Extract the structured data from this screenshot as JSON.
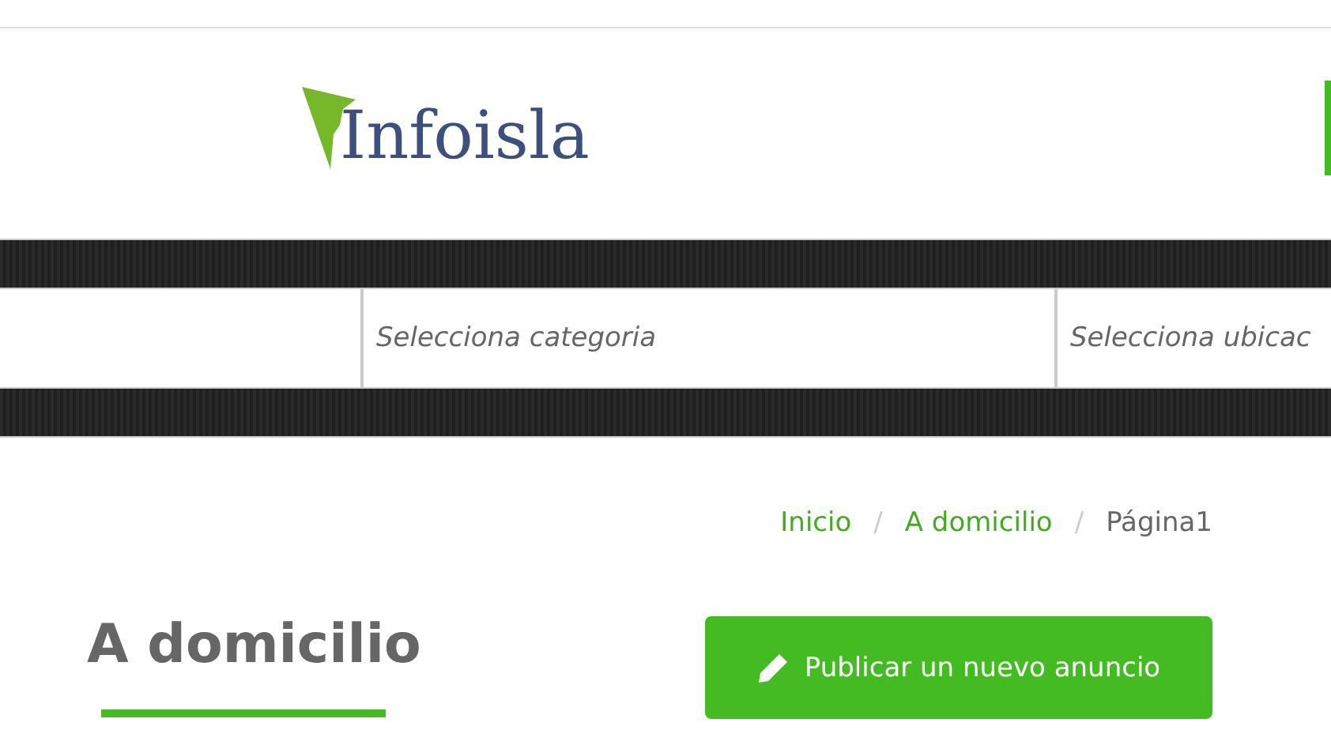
{
  "header": {
    "logo": {
      "text": "Infoisla"
    }
  },
  "search_bar": {
    "fields": [
      {
        "kind": "text"
      },
      {
        "kind": "select",
        "placeholder": "Selecciona categoria"
      },
      {
        "kind": "select",
        "placeholder": "Selecciona ubicac"
      }
    ]
  },
  "breadcrumb": [
    {
      "label": "Inicio",
      "link": true
    },
    {
      "label": "A domicilio",
      "link": true
    },
    {
      "label": "Página1",
      "link": false
    }
  ],
  "breadcrumb_separator": "/",
  "page_title": "A domicilio",
  "publish_button": {
    "label": "Publicar un nuevo anuncio"
  }
}
